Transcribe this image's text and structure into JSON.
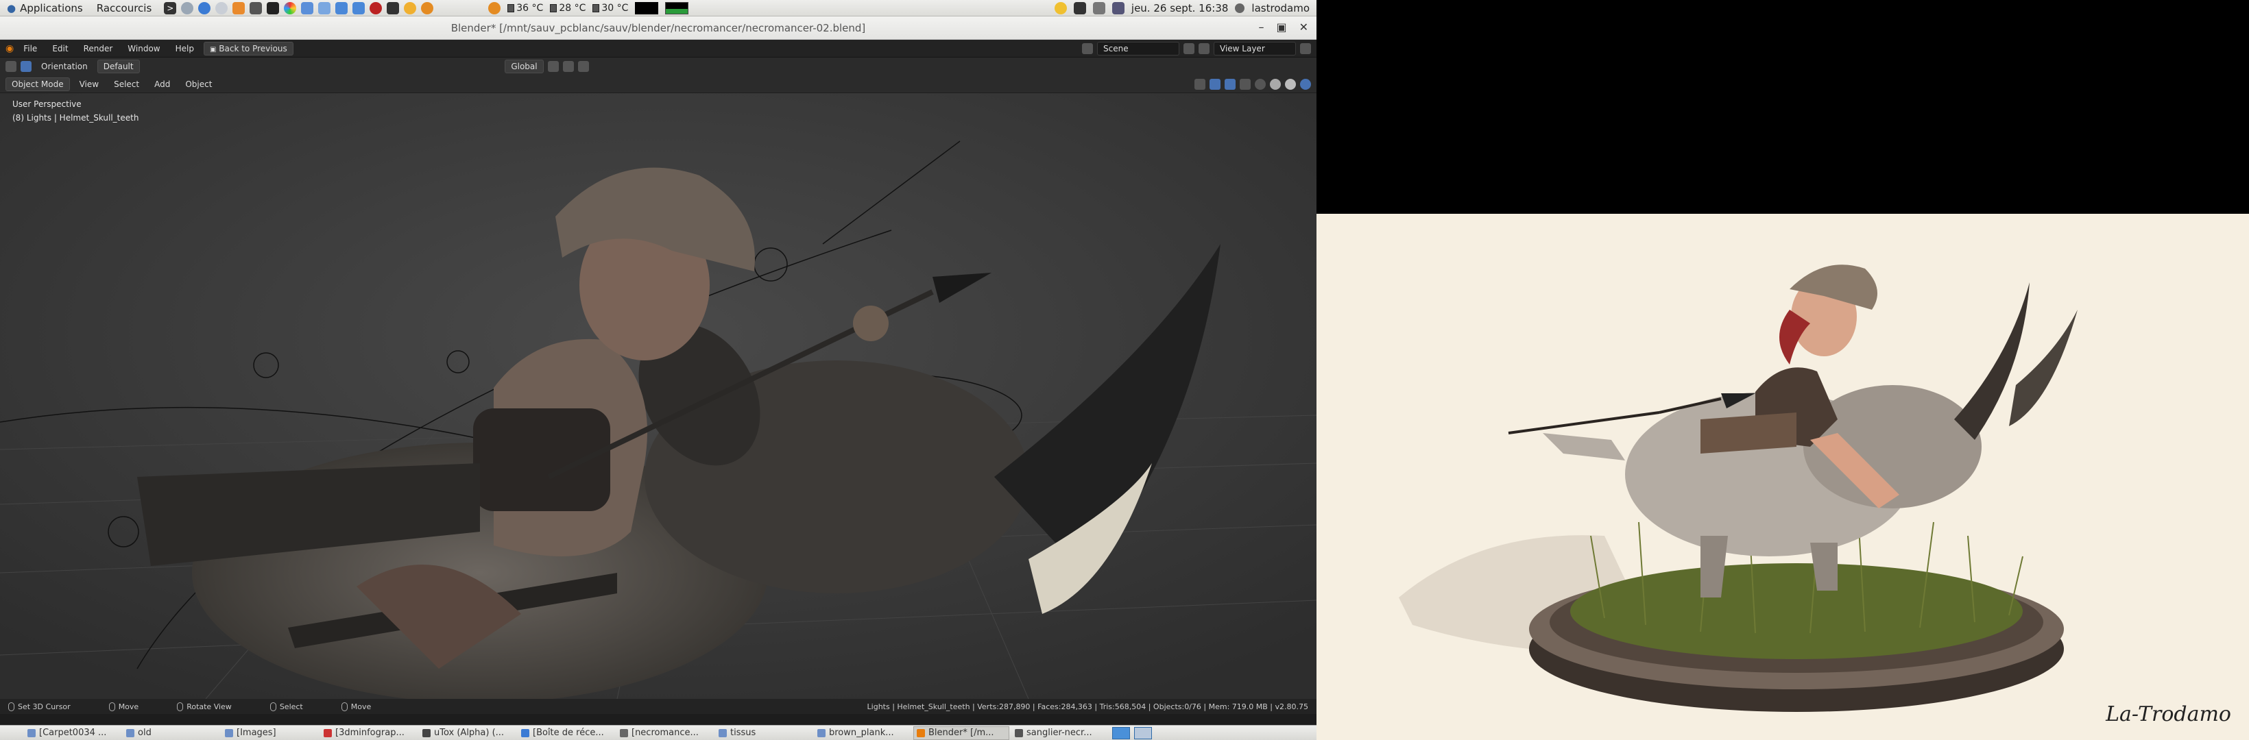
{
  "top_panel": {
    "applications": "Applications",
    "shortcuts": "Raccourcis",
    "temps": [
      "36 °C",
      "28 °C",
      "30 °C"
    ],
    "datetime": "jeu. 26 sept. 16:38",
    "user": "lastrodamo"
  },
  "window": {
    "title": "Blender* [/mnt/sauv_pcblanc/sauv/blender/necromancer/necromancer-02.blend]"
  },
  "topbar": {
    "menus": [
      "File",
      "Edit",
      "Render",
      "Window",
      "Help"
    ],
    "back": "Back to Previous",
    "scene": "Scene",
    "view_layer": "View Layer"
  },
  "header": {
    "orientation_label": "Orientation",
    "orientation_value": "Default",
    "transform": "Global"
  },
  "tools": {
    "mode": "Object Mode",
    "menus": [
      "View",
      "Select",
      "Add",
      "Object"
    ]
  },
  "viewport": {
    "perspective": "User Perspective",
    "active": "(8) Lights | Helmet_Skull_teeth"
  },
  "statusbar": {
    "cursor": "Set 3D Cursor",
    "move": "Move",
    "rotate": "Rotate View",
    "select": "Select",
    "move2": "Move",
    "stats": "Lights | Helmet_Skull_teeth | Verts:287,890 | Faces:284,363 | Tris:568,504 | Objects:0/76 | Mem: 719.0 MB | v2.80.75"
  },
  "taskbar": {
    "tasks": [
      {
        "label": "[Carpet0034 ..."
      },
      {
        "label": "old"
      },
      {
        "label": "[Images]"
      },
      {
        "label": "[3dminfograp..."
      },
      {
        "label": "uTox (Alpha) (..."
      },
      {
        "label": "[Boîte de réce..."
      },
      {
        "label": "[necromance..."
      },
      {
        "label": "tissus"
      },
      {
        "label": "brown_plank..."
      },
      {
        "label": "Blender* [/m..."
      },
      {
        "label": "sanglier-necr..."
      }
    ]
  },
  "render": {
    "signature": "La-Trodamo"
  }
}
